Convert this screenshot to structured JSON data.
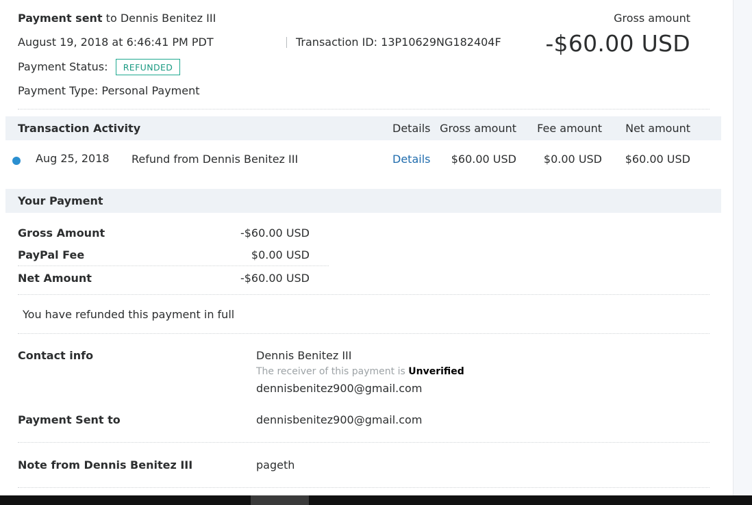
{
  "header": {
    "payment_sent_bold": "Payment sent",
    "payment_sent_to": " to Dennis Benitez III",
    "datetime": "August 19, 2018 at 6:46:41 PM PDT",
    "transaction_id_label": "Transaction ID: 13P10629NG182404F",
    "payment_status_label": "Payment Status:",
    "payment_status_value": "REFUNDED",
    "payment_type": "Payment Type: Personal Payment",
    "gross_label": "Gross amount",
    "gross_value": "-$60.00 USD"
  },
  "activity": {
    "title": "Transaction Activity",
    "columns": {
      "details": "Details",
      "gross": "Gross amount",
      "fee": "Fee amount",
      "net": "Net amount"
    },
    "rows": [
      {
        "date": "Aug 25, 2018",
        "description": "Refund from Dennis Benitez III",
        "details": "Details",
        "gross": "$60.00 USD",
        "fee": "$0.00 USD",
        "net": "$60.00 USD"
      }
    ]
  },
  "your_payment": {
    "title": "Your Payment",
    "gross_label": "Gross Amount",
    "gross_value": "-$60.00 USD",
    "fee_label": "PayPal Fee",
    "fee_value": "$0.00 USD",
    "net_label": "Net Amount",
    "net_value": "-$60.00 USD",
    "refund_note": "You have refunded this payment in full"
  },
  "contact": {
    "label": "Contact info",
    "name": "Dennis Benitez III",
    "receiver_text": "The receiver of this payment is ",
    "receiver_status": "Unverified",
    "email": "dennisbenitez900@gmail.com"
  },
  "sent_to": {
    "label": "Payment Sent to",
    "value": "dennisbenitez900@gmail.com"
  },
  "note": {
    "label": "Note from Dennis Benitez III",
    "value": "pageth"
  },
  "colors": {
    "refunded_badge": "#1ea88f",
    "link": "#1f6cad",
    "activity_dot": "#2b8fd0",
    "section_band": "#eef2f6"
  }
}
